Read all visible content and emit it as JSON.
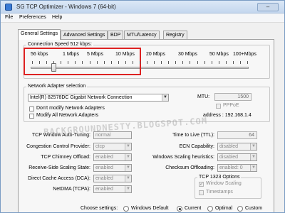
{
  "window": {
    "title": "SG TCP Optimizer - Windows 7 (64-bit)",
    "title_controls": "–"
  },
  "menu": [
    "File",
    "Preferences",
    "Help"
  ],
  "tabs": [
    "General Settings",
    "Advanced Settings",
    "BDP",
    "MTU/Latency",
    "Registry"
  ],
  "connection_speed": {
    "label": "Connection Speed  512 kbps:",
    "ticks": [
      "56 kbps",
      "1 Mbps",
      "5 Mbps",
      "10 Mbps",
      "20 Mbps",
      "30 Mbps",
      "50 Mbps",
      "100+Mbps"
    ],
    "selected_value_label": "512 kbps"
  },
  "adapter": {
    "group_label": "Network Adapter selection",
    "selected": "Intel(R) 82578DC Gigabit Network Connection",
    "mtu_label": "MTU:",
    "mtu_value": "1500",
    "pppoe_label": "PPPoE",
    "dont_modify_label": "Don't modify Network Adapters",
    "modify_all_label": "Modify All Network Adapters",
    "ip_label": "address : 192.168.1.4"
  },
  "settings_left": [
    {
      "label": "TCP Window Auto-Tuning:",
      "value": "normal"
    },
    {
      "label": "Congestion Control Provider:",
      "value": "ctcp"
    },
    {
      "label": "TCP Chimney Offload:",
      "value": "enabled"
    },
    {
      "label": "Receive-Side Scaling State:",
      "value": "enabled"
    },
    {
      "label": "Direct Cache Access (DCA):",
      "value": "enabled"
    },
    {
      "label": "NetDMA (TCPA):",
      "value": "enabled"
    }
  ],
  "settings_right": [
    {
      "label": "Time to Live (TTL):",
      "value": "64"
    },
    {
      "label": "ECN Capability:",
      "value": "disabled"
    },
    {
      "label": "Windows Scaling heuristics:",
      "value": "disabled"
    },
    {
      "label": "Checksum Offloading:",
      "value": "enabled: 0"
    }
  ],
  "tcp1323": {
    "group_label": "TCP 1323 Options",
    "window_scaling": "Window Scaling",
    "timestamps": "Timestamps"
  },
  "choose": {
    "label": "Choose settings:",
    "options": [
      "Windows Default",
      "Current",
      "Optimal",
      "Custom"
    ],
    "selected": "Current"
  },
  "watermark": "BACKGROUNDNESTY.BLOGSPOT.COM"
}
